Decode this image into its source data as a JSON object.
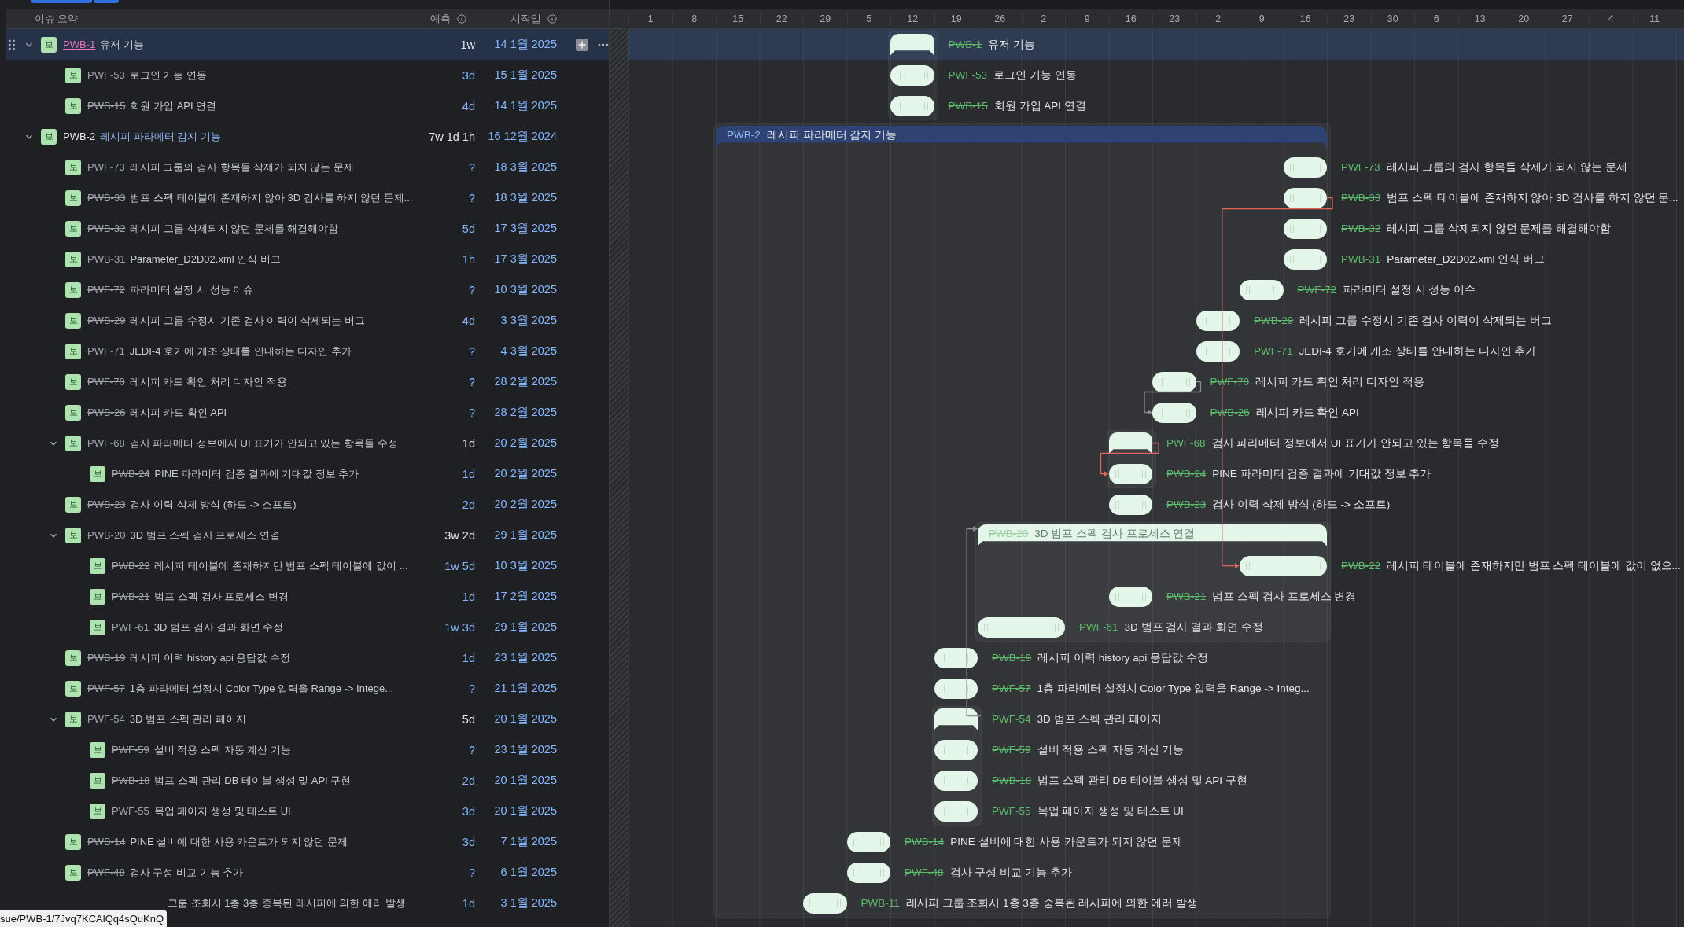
{
  "list_header": {
    "columns": [
      {
        "label": "이슈 요약",
        "info": false
      },
      {
        "label": "예측",
        "info": true
      },
      {
        "label": "시작일",
        "info": true
      }
    ]
  },
  "timeline": {
    "weeks": [
      "1",
      "8",
      "15",
      "22",
      "29",
      "5",
      "12",
      "19",
      "26",
      "2",
      "9",
      "16",
      "23",
      "2",
      "9",
      "16",
      "23",
      "30",
      "6",
      "13",
      "20",
      "27",
      "4",
      "11"
    ]
  },
  "issues": [
    {
      "type": "보",
      "key": "PWB-1",
      "summary": "유저 기능",
      "estimate": "1w",
      "start": "14 1월 2025",
      "done": true,
      "selected": true,
      "expanded": true,
      "bar": {
        "key": "PWB-1",
        "label": "유저 기능"
      },
      "children": [
        {
          "type": "보",
          "key": "PWF-53",
          "summary": "로그인 기능 연동",
          "estimate": "3d",
          "start": "15 1월 2025",
          "done": true,
          "selected": false,
          "bar": {
            "key": "PWF-53",
            "label": "로그인 기능 연동"
          }
        },
        {
          "type": "보",
          "key": "PWB-15",
          "summary": "회원 가입 API 연결",
          "estimate": "4d",
          "start": "14 1월 2025",
          "done": true,
          "selected": false,
          "bar": {
            "key": "PWB-15",
            "label": "회원 가입 API 연결"
          }
        }
      ]
    },
    {
      "type": "보",
      "key": "PWB-2",
      "summary": "레시피 파라메터 감지 기능",
      "estimate": "7w 1d 1h",
      "start": "16 12월 2024",
      "done": false,
      "selected": false,
      "expanded": true,
      "bar": {
        "key": "PWB-2",
        "label": "레시피 파라메터 감지 기능"
      },
      "children": [
        {
          "type": "보",
          "key": "PWF-73",
          "summary": "레시피 그룹의 검사 항목들 삭제가 되지 않는 문제",
          "estimate": "?",
          "start": "18 3월 2025",
          "done": true,
          "selected": false,
          "bar": {
            "key": "PWF-73",
            "label": "레시피 그룹의 검사 항목들 삭제가 되지 않는 문제"
          }
        },
        {
          "type": "보",
          "key": "PWB-33",
          "summary": "범프 스펙 테이블에 존재하지 않아 3D 검사를 하지 않던 문제...",
          "estimate": "?",
          "start": "18 3월 2025",
          "done": true,
          "selected": false,
          "bar": {
            "key": "PWB-33",
            "label": "범프 스펙 테이블에 존재하지 않아 3D 검사를 하지 않던 문..."
          }
        },
        {
          "type": "보",
          "key": "PWB-32",
          "summary": "레시피 그룹 삭제되지 않던 문제를 해결해야함",
          "estimate": "5d",
          "start": "17 3월 2025",
          "done": true,
          "selected": false,
          "bar": {
            "key": "PWB-32",
            "label": "레시피 그룹 삭제되지 않던 문제를 해결해야함"
          }
        },
        {
          "type": "보",
          "key": "PWB-31",
          "summary": "Parameter_D2D02.xml 인식 버그",
          "estimate": "1h",
          "start": "17 3월 2025",
          "done": true,
          "selected": false,
          "bar": {
            "key": "PWB-31",
            "label": "Parameter_D2D02.xml 인식 버그"
          }
        },
        {
          "type": "보",
          "key": "PWF-72",
          "summary": "파라미터 설정 시 성능 이슈",
          "estimate": "?",
          "start": "10 3월 2025",
          "done": true,
          "selected": false,
          "bar": {
            "key": "PWF-72",
            "label": "파라미터 설정 시 성능 이슈"
          }
        },
        {
          "type": "보",
          "key": "PWB-29",
          "summary": "레시피 그룹 수정시 기존 검사 이력이 삭제되는 버그",
          "estimate": "4d",
          "start": "3 3월 2025",
          "done": true,
          "selected": false,
          "bar": {
            "key": "PWB-29",
            "label": "레시피 그룹 수정시 기존 검사 이력이 삭제되는 버그"
          }
        },
        {
          "type": "보",
          "key": "PWF-71",
          "summary": "JEDI-4 호기에 개조 상태를 안내하는 디자인 추가",
          "estimate": "?",
          "start": "4 3월 2025",
          "done": true,
          "selected": false,
          "bar": {
            "key": "PWF-71",
            "label": "JEDI-4 호기에 개조 상태를 안내하는 디자인 추가"
          }
        },
        {
          "type": "보",
          "key": "PWF-70",
          "summary": "레시피 카드 확인 처리 디자인 적용",
          "estimate": "?",
          "start": "28 2월 2025",
          "done": true,
          "selected": false,
          "bar": {
            "key": "PWF-70",
            "label": "레시피 카드 확인 처리 디자인 적용"
          }
        },
        {
          "type": "보",
          "key": "PWB-26",
          "summary": "레시피 카드 확인 API",
          "estimate": "?",
          "start": "28 2월 2025",
          "done": true,
          "selected": false,
          "bar": {
            "key": "PWB-26",
            "label": "레시피 카드 확인 API"
          }
        },
        {
          "type": "보",
          "key": "PWF-68",
          "summary": "검사 파라메터 정보에서 UI 표기가 안되고 있는 항목들 수정",
          "estimate": "1d",
          "start": "20 2월 2025",
          "done": true,
          "selected": false,
          "expanded": true,
          "bar": {
            "key": "PWF-68",
            "label": "검사 파라메터 정보에서 UI 표기가 안되고 있는 항목들 수정"
          },
          "children": [
            {
              "type": "보",
              "key": "PWB-24",
              "summary": "PINE 파라미터 검증 결과에 기대값 정보 추가",
              "estimate": "1d",
              "start": "20 2월 2025",
              "done": true,
              "selected": false,
              "bar": {
                "key": "PWB-24",
                "label": "PINE 파라미터 검증 결과에 기대값 정보 추가"
              }
            }
          ]
        },
        {
          "type": "보",
          "key": "PWB-23",
          "summary": "검사 이력 삭제 방식 (하드 -> 소프트)",
          "estimate": "2d",
          "start": "20 2월 2025",
          "done": true,
          "selected": false,
          "bar": {
            "key": "PWB-23",
            "label": "검사 이력 삭제 방식 (하드 -> 소프트)"
          }
        },
        {
          "type": "보",
          "key": "PWB-20",
          "summary": "3D 범프 스펙 검사 프로세스 연결",
          "estimate": "3w 2d",
          "start": "29 1월 2025",
          "done": true,
          "selected": false,
          "expanded": true,
          "bar": {
            "key": "PWB-20",
            "label": "3D 범프 스펙 검사 프로세스 연결"
          },
          "children": [
            {
              "type": "보",
              "key": "PWB-22",
              "summary": "레시피 테이블에 존재하지만 범프 스펙 테이블에 값이 ...",
              "estimate": "1w 5d",
              "start": "10 3월 2025",
              "done": true,
              "selected": false,
              "bar": {
                "key": "PWB-22",
                "label": "레시피 테이블에 존재하지만 범프 스펙 테이블에 값이 없으..."
              }
            },
            {
              "type": "보",
              "key": "PWB-21",
              "summary": "범프 스펙 검사 프로세스 변경",
              "estimate": "1d",
              "start": "17 2월 2025",
              "done": true,
              "selected": false,
              "bar": {
                "key": "PWB-21",
                "label": "범프 스펙 검사 프로세스 변경"
              }
            },
            {
              "type": "보",
              "key": "PWF-61",
              "summary": "3D 범프 검사 결과 화면 수정",
              "estimate": "1w 3d",
              "start": "29 1월 2025",
              "done": true,
              "selected": false,
              "bar": {
                "key": "PWF-61",
                "label": "3D 범프 검사 결과 화면 수정"
              }
            }
          ]
        },
        {
          "type": "보",
          "key": "PWB-19",
          "summary": "레시피 이력 history api 응답값 수정",
          "estimate": "1d",
          "start": "23 1월 2025",
          "done": true,
          "selected": false,
          "bar": {
            "key": "PWB-19",
            "label": "레시피 이력 history api 응답값 수정"
          }
        },
        {
          "type": "보",
          "key": "PWF-57",
          "summary": "1층 파라메터 설정시 Color Type 입력을 Range -> Intege...",
          "estimate": "?",
          "start": "21 1월 2025",
          "done": true,
          "selected": false,
          "bar": {
            "key": "PWF-57",
            "label": "1층 파라메터 설정시 Color Type 입력을 Range -> Integ..."
          }
        },
        {
          "type": "보",
          "key": "PWF-54",
          "summary": "3D 범프 스펙 관리 페이지",
          "estimate": "5d",
          "start": "20 1월 2025",
          "done": true,
          "selected": false,
          "expanded": true,
          "bar": {
            "key": "PWF-54",
            "label": "3D 범프 스펙 관리 페이지"
          },
          "children": [
            {
              "type": "보",
              "key": "PWF-59",
              "summary": "설비 적용 스펙 자동 계산 기능",
              "estimate": "?",
              "start": "23 1월 2025",
              "done": true,
              "selected": false,
              "bar": {
                "key": "PWF-59",
                "label": "설비 적용 스펙 자동 계산 기능"
              }
            },
            {
              "type": "보",
              "key": "PWB-18",
              "summary": "범프 스펙 관리 DB 테이블 생성 및 API 구현",
              "estimate": "2d",
              "start": "20 1월 2025",
              "done": true,
              "selected": false,
              "bar": {
                "key": "PWB-18",
                "label": "범프 스펙 관리 DB 테이블 생성 및 API 구현"
              }
            },
            {
              "type": "보",
              "key": "PWF-55",
              "summary": "목업 페이지 생성 및 테스트 UI",
              "estimate": "3d",
              "start": "20 1월 2025",
              "done": true,
              "selected": false,
              "bar": {
                "key": "PWF-55",
                "label": "목업 페이지 생성 및 테스트 UI"
              }
            }
          ]
        },
        {
          "type": "보",
          "key": "PWB-14",
          "summary": "PINE 설비에 대한 사용 카운트가 되지 않던 문제",
          "estimate": "3d",
          "start": "7 1월 2025",
          "done": true,
          "selected": false,
          "bar": {
            "key": "PWB-14",
            "label": "PINE 설비에 대한 사용 카운트가 되지 않던 문제"
          }
        },
        {
          "type": "보",
          "key": "PWF-48",
          "summary": "검사 구성 비교 기능 추가",
          "estimate": "?",
          "start": "6 1월 2025",
          "done": true,
          "selected": false,
          "bar": {
            "key": "PWF-48",
            "label": "검사 구성 비교 기능 추가"
          }
        },
        {
          "summary": "그룹 조회시 1층 3층 중복된 레시피에 의한 에러 발생",
          "estimate": "1d",
          "start": "3 1월 2025",
          "done": true,
          "selected": false,
          "bar": {
            "key": "PWB-11",
            "label": "레시피 그룹 조회시 1층 3층 중복된 레시피에 의한 에러 발생"
          }
        }
      ]
    }
  ],
  "link_tooltip": {
    "url": "sue/PWB-1/7Jvq7KCAlQq4sQuKnQ"
  }
}
